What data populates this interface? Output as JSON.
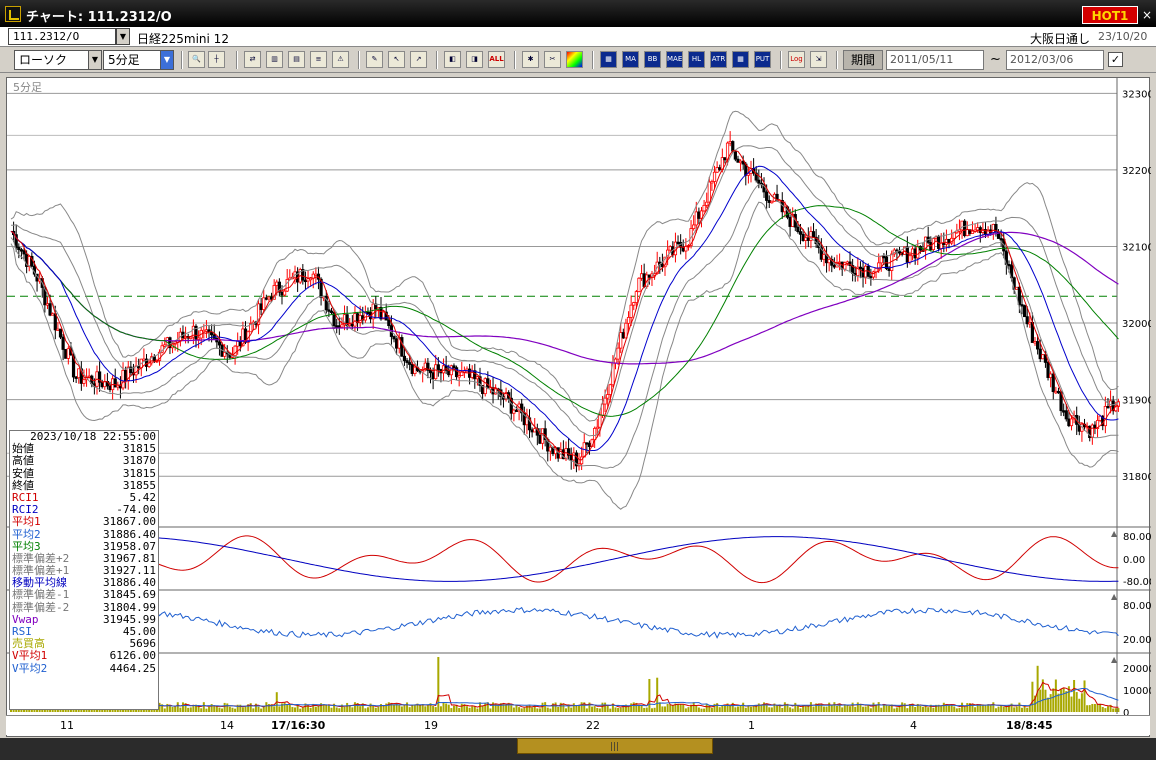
{
  "window": {
    "title": "チャート: 111.2312/O",
    "hot_label": "HOT1",
    "close_label": "×"
  },
  "symbol_bar": {
    "code": "111.2312/O",
    "name": "日経225mini 12",
    "market": "大阪日通し",
    "market_date": "23/10/20"
  },
  "toolbar": {
    "chart_type": "ローソク",
    "interval": "5分足",
    "period_button": "期間",
    "date_from": "2011/05/11",
    "date_to": "2012/03/06",
    "tilde": "~",
    "indicator_buttons": [
      "MA",
      "BB",
      "MAE",
      "HL",
      "ATR",
      "PUT"
    ],
    "log_button": "Log"
  },
  "chart": {
    "interval_label": "5分足",
    "y_ticks": [
      "32300",
      "32200",
      "32100",
      "32000",
      "31900",
      "31800"
    ],
    "osc1_ticks": [
      "80.00",
      "0.00",
      "-80.00"
    ],
    "osc2_ticks": [
      "80.00",
      "20.00"
    ],
    "vol_ticks": [
      "20000",
      "10000",
      "0"
    ],
    "x_ticks": [
      {
        "label": "11",
        "bold": false
      },
      {
        "label": "14",
        "bold": false
      },
      {
        "label": "17/16:30",
        "bold": true
      },
      {
        "label": "19",
        "bold": false
      },
      {
        "label": "22",
        "bold": false
      },
      {
        "label": "1",
        "bold": false
      },
      {
        "label": "4",
        "bold": false
      },
      {
        "label": "18/8:45",
        "bold": true
      }
    ],
    "colors": {
      "up": "#ff0000",
      "down": "#000000",
      "ma1": "#e00000",
      "ma2": "#0000cc",
      "ma3": "#008000",
      "vwap": "#8000c0",
      "rsi": "#2060d0",
      "volume": "#a8a800",
      "band": "#888888",
      "dashed": "#008000"
    }
  },
  "info": {
    "datetime": "2023/10/18  22:55:00",
    "rows": [
      {
        "label": "始値",
        "value": "31815",
        "color": "#000000"
      },
      {
        "label": "高値",
        "value": "31870",
        "color": "#000000"
      },
      {
        "label": "安値",
        "value": "31815",
        "color": "#000000"
      },
      {
        "label": "終値",
        "value": "31855",
        "color": "#000000"
      },
      {
        "label": "RCI1",
        "value": "5.42",
        "color": "#d00000"
      },
      {
        "label": "RCI2",
        "value": "-74.00",
        "color": "#0000c0"
      },
      {
        "label": "平均1",
        "value": "31867.00",
        "color": "#d00000"
      },
      {
        "label": "平均2",
        "value": "31886.40",
        "color": "#2060d0"
      },
      {
        "label": "平均3",
        "value": "31958.07",
        "color": "#008000"
      },
      {
        "label": "標準偏差+2",
        "value": "31967.81",
        "color": "#777777"
      },
      {
        "label": "標準偏差+1",
        "value": "31927.11",
        "color": "#777777"
      },
      {
        "label": "移動平均線",
        "value": "31886.40",
        "color": "#0000c0"
      },
      {
        "label": "標準偏差-1",
        "value": "31845.69",
        "color": "#777777"
      },
      {
        "label": "標準偏差-2",
        "value": "31804.99",
        "color": "#777777"
      },
      {
        "label": "Vwap",
        "value": "31945.99",
        "color": "#8000c0"
      },
      {
        "label": "RSI",
        "value": "45.00",
        "color": "#2060d0"
      },
      {
        "label": "売買高",
        "value": "5696",
        "color": "#a8a800"
      },
      {
        "label": "V平均1",
        "value": "6126.00",
        "color": "#d00000"
      },
      {
        "label": "V平均2",
        "value": "4464.25",
        "color": "#2060d0"
      }
    ]
  }
}
